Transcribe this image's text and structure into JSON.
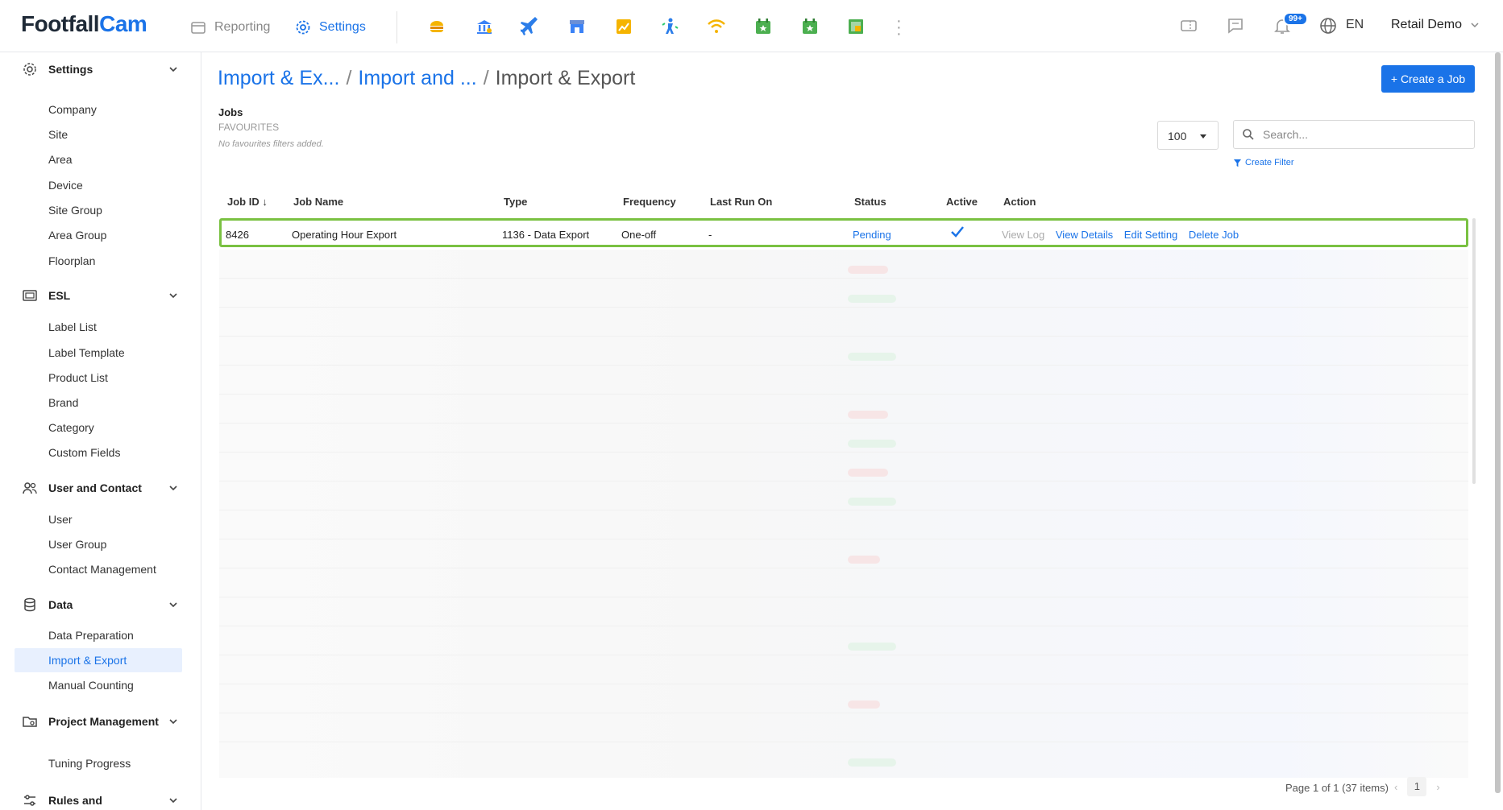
{
  "brand": {
    "part1": "Footfall",
    "part2": "Cam"
  },
  "top_nav": {
    "reporting": "Reporting",
    "settings": "Settings"
  },
  "header_right": {
    "notification_badge": "99+",
    "language": "EN",
    "account": "Retail Demo"
  },
  "sidebar": {
    "sections": [
      {
        "label": "Settings",
        "items": [
          "Company",
          "Site",
          "Area",
          "Device",
          "Site Group",
          "Area Group",
          "Floorplan"
        ]
      },
      {
        "label": "ESL",
        "items": [
          "Label List",
          "Label Template",
          "Product List",
          "Brand",
          "Category",
          "Custom Fields"
        ]
      },
      {
        "label": "User and Contact",
        "items": [
          "User",
          "User Group",
          "Contact Management"
        ]
      },
      {
        "label": "Data",
        "items": [
          "Data Preparation",
          "Import & Export",
          "Manual Counting"
        ]
      },
      {
        "label": "Project Management",
        "items": [
          "Tuning Progress"
        ]
      },
      {
        "label": "Rules and",
        "items": []
      }
    ],
    "active_item": "Import & Export"
  },
  "breadcrumb": {
    "crumb1": "Import & Ex...",
    "crumb2": "Import and ...",
    "current": "Import & Export",
    "sep": "/"
  },
  "toolbar": {
    "create_job": "+ Create a Job",
    "page_size": "100",
    "search_placeholder": "Search...",
    "create_filter": "Create Filter"
  },
  "jobs": {
    "title": "Jobs",
    "favourites_label": "FAVOURITES",
    "favourites_empty": "No favourites filters added."
  },
  "table": {
    "headers": {
      "job_id": "Job ID",
      "job_name": "Job Name",
      "type": "Type",
      "frequency": "Frequency",
      "last_run_on": "Last Run On",
      "status": "Status",
      "active": "Active",
      "action": "Action"
    },
    "rows": [
      {
        "job_id": "8426",
        "job_name": "Operating Hour Export",
        "type": "1136 - Data Export",
        "frequency": "One-off",
        "last_run_on": "-",
        "status": "Pending",
        "active": true,
        "actions": {
          "view_log": "View Log",
          "view_details": "View Details",
          "edit_setting": "Edit Setting",
          "delete_job": "Delete Job"
        }
      }
    ]
  },
  "pagination": {
    "summary": "Page 1 of 1 (37 items)",
    "current_page": "1"
  },
  "colors": {
    "accent": "#1a73e8",
    "highlight_border": "#7ac142",
    "active_bg": "#e8f0fe"
  }
}
